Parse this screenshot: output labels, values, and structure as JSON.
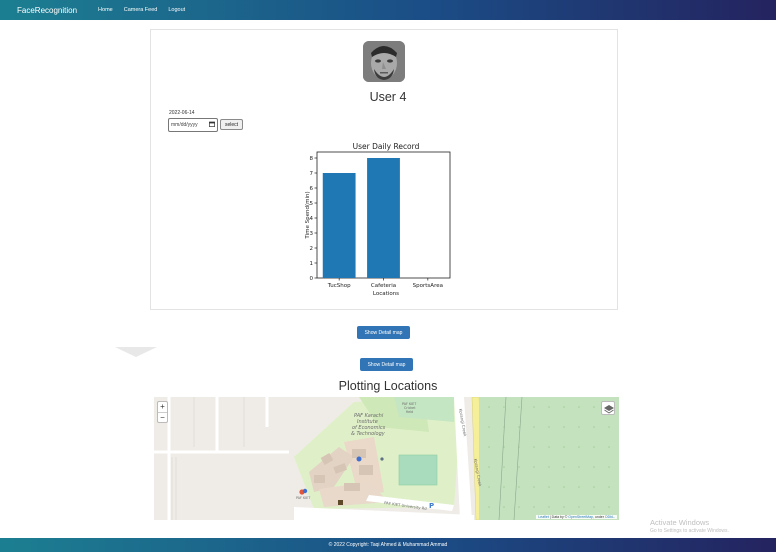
{
  "navbar": {
    "brand": "FaceRecognition",
    "links": [
      "Home",
      "Camera Feed",
      "Logout"
    ]
  },
  "profile": {
    "user_name": "User 4",
    "selected_date": "2022-06-14",
    "date_input_placeholder": "mm/dd/yyyy",
    "date_icon": "calendar-icon",
    "select_label": "select"
  },
  "chart_data": {
    "type": "bar",
    "title": "User Daily Record",
    "xlabel": "Locations",
    "ylabel": "Time Spend(min)",
    "categories": [
      "TucShop",
      "Cafeteria",
      "SportsArea"
    ],
    "values": [
      7,
      8,
      0
    ],
    "ylim": [
      0,
      8.4
    ],
    "yticks": [
      0,
      1,
      2,
      3,
      4,
      5,
      6,
      7,
      8
    ],
    "bar_color": "#1f77b4",
    "grid": false
  },
  "buttons": {
    "detail_map_1": "Show Detail map",
    "detail_map_2": "Show Detail map"
  },
  "map": {
    "title": "Plotting Locations",
    "zoom_in": "+",
    "zoom_out": "−",
    "layers_icon": "layers-icon",
    "labels": {
      "institute": "PAF Karachi\nInstitute\nof Economics\n& Technology",
      "small_top": "PAF KIET\nCricket\nfield",
      "road_1": "Korangi Creek",
      "road_2": "Korangi Creek",
      "bottom_road": "PAF KIET University Rd",
      "marker_label": "PAF KIET"
    },
    "attribution_leaflet": "Leaflet",
    "attribution_text": " | Data by © ",
    "attribution_osm": "OpenStreetMap",
    "attribution_under": ", under ",
    "attribution_license": "ODbL."
  },
  "footer": {
    "copyright": "© 2022 Copyright: Taqi Ahmed & Muhammad Ammad"
  },
  "watermark": {
    "line1": "Activate Windows",
    "line2": "Go to Settings to activate Windows."
  }
}
